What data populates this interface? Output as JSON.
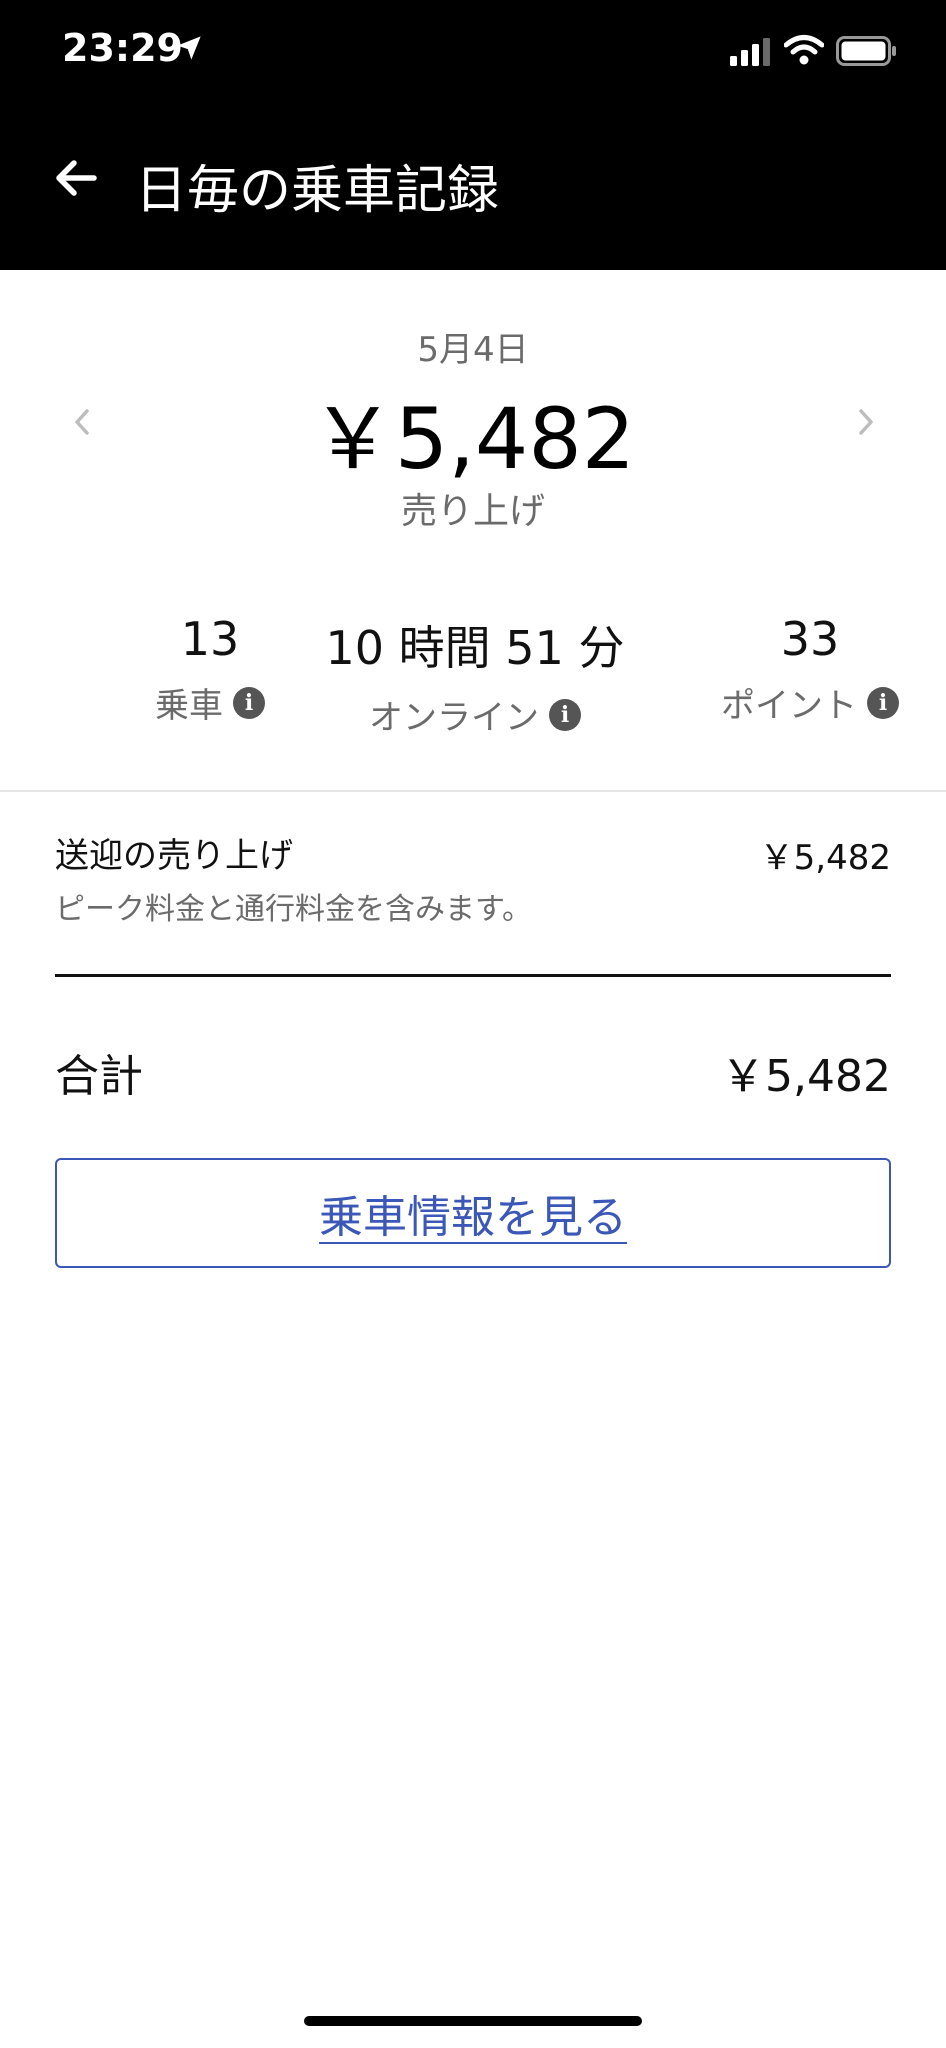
{
  "status_bar": {
    "time": "23:29"
  },
  "header": {
    "title": "日毎の乗車記録",
    "background": "#000000"
  },
  "summary": {
    "date": "5月4日",
    "amount": "￥5,482",
    "caption": "売り上げ"
  },
  "stats": [
    {
      "value": "13",
      "label": "乗車"
    },
    {
      "value": "10 時間 51 分",
      "label": "オンライン"
    },
    {
      "value": "33",
      "label": "ポイント"
    }
  ],
  "breakdown": {
    "row_title": "送迎の売り上げ",
    "row_amount": "￥5,482",
    "row_note": "ピーク料金と通行料金を含みます。",
    "total_label": "合計",
    "total_value": "￥5,482"
  },
  "actions": {
    "details_button": "乗車情報を見る",
    "accent_color": "#3b57b8"
  },
  "icons": {
    "back": "back-arrow-icon",
    "prev": "chevron-left-icon",
    "next": "chevron-right-icon",
    "info": "info-icon",
    "location": "location-arrow-icon",
    "signal": "cellular-signal-icon",
    "wifi": "wifi-icon",
    "battery": "battery-icon"
  }
}
